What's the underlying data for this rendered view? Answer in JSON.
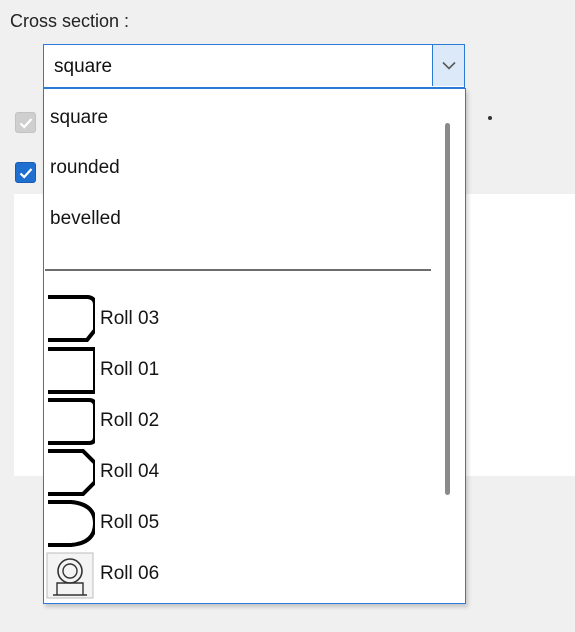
{
  "form": {
    "cross_section_label": "Cross section :"
  },
  "combo": {
    "value": "square",
    "arrow_icon": "chevron-down-icon"
  },
  "dropdown": {
    "options": [
      "square",
      "rounded",
      "bevelled"
    ],
    "rolls": [
      {
        "label": "Roll 03",
        "icon": "roll-03-profile-icon"
      },
      {
        "label": "Roll 01",
        "icon": "roll-01-profile-icon"
      },
      {
        "label": "Roll 02",
        "icon": "roll-02-profile-icon"
      },
      {
        "label": "Roll 04",
        "icon": "roll-04-profile-icon"
      },
      {
        "label": "Roll 05",
        "icon": "roll-05-profile-icon"
      },
      {
        "label": "Roll 06",
        "icon": "roll-06-profile-icon"
      }
    ]
  },
  "colors": {
    "accent": "#2b7ad8",
    "checkbox_checked": "#1f6fd0",
    "checkbox_disabled": "#cfcfcf"
  }
}
